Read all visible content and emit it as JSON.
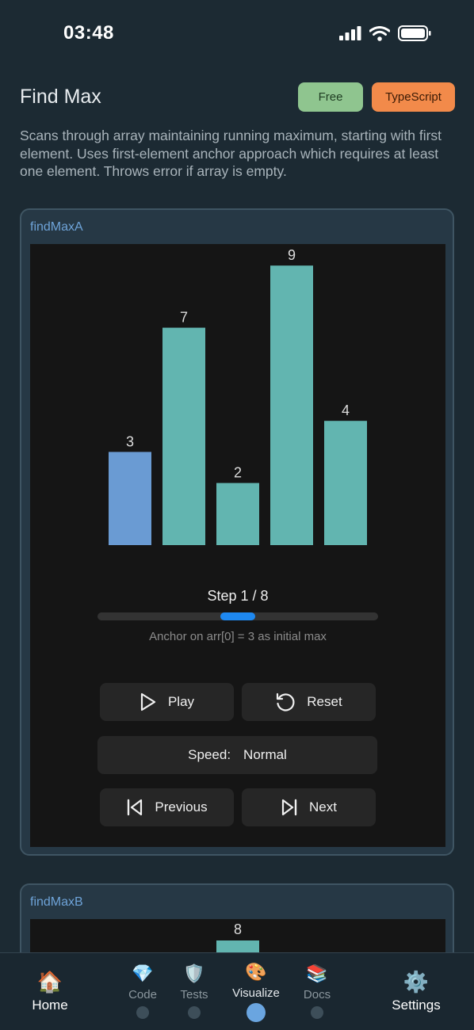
{
  "status": {
    "time": "03:48"
  },
  "header": {
    "title": "Find Max",
    "badge_free": "Free",
    "badge_lang": "TypeScript",
    "description": "Scans through array maintaining running maximum, starting with first element. Uses first-element anchor approach which requires at least one element. Throws error if array is empty."
  },
  "colors": {
    "bar": "#62b5b0",
    "bar_active": "#6a9bd3",
    "accent": "#1e88f0"
  },
  "card_a": {
    "title": "findMaxA",
    "chart_data": {
      "type": "bar",
      "values": [
        3,
        7,
        2,
        9,
        4
      ],
      "active_index": 0,
      "data_labels": [
        "3",
        "7",
        "2",
        "9",
        "4"
      ]
    },
    "step_label": "Step 1 / 8",
    "step_current": 1,
    "step_total": 8,
    "step_desc": "Anchor on arr[0] = 3 as initial max",
    "play_label": "Play",
    "reset_label": "Reset",
    "speed_label": "Speed:",
    "speed_value": "Normal",
    "prev_label": "Previous",
    "next_label": "Next"
  },
  "card_b": {
    "title": "findMaxB",
    "visible_label": "8"
  },
  "tabs": [
    {
      "label": "Home",
      "icon": "house-icon",
      "glyph": "🏠"
    },
    {
      "label": "Code",
      "icon": "gem-icon",
      "glyph": "💎"
    },
    {
      "label": "Tests",
      "icon": "shield-icon",
      "glyph": "🛡️"
    },
    {
      "label": "Visualize",
      "icon": "palette-icon",
      "glyph": "🎨"
    },
    {
      "label": "Docs",
      "icon": "books-icon",
      "glyph": "📚"
    },
    {
      "label": "Settings",
      "icon": "gear-icon",
      "glyph": "⚙️"
    }
  ]
}
